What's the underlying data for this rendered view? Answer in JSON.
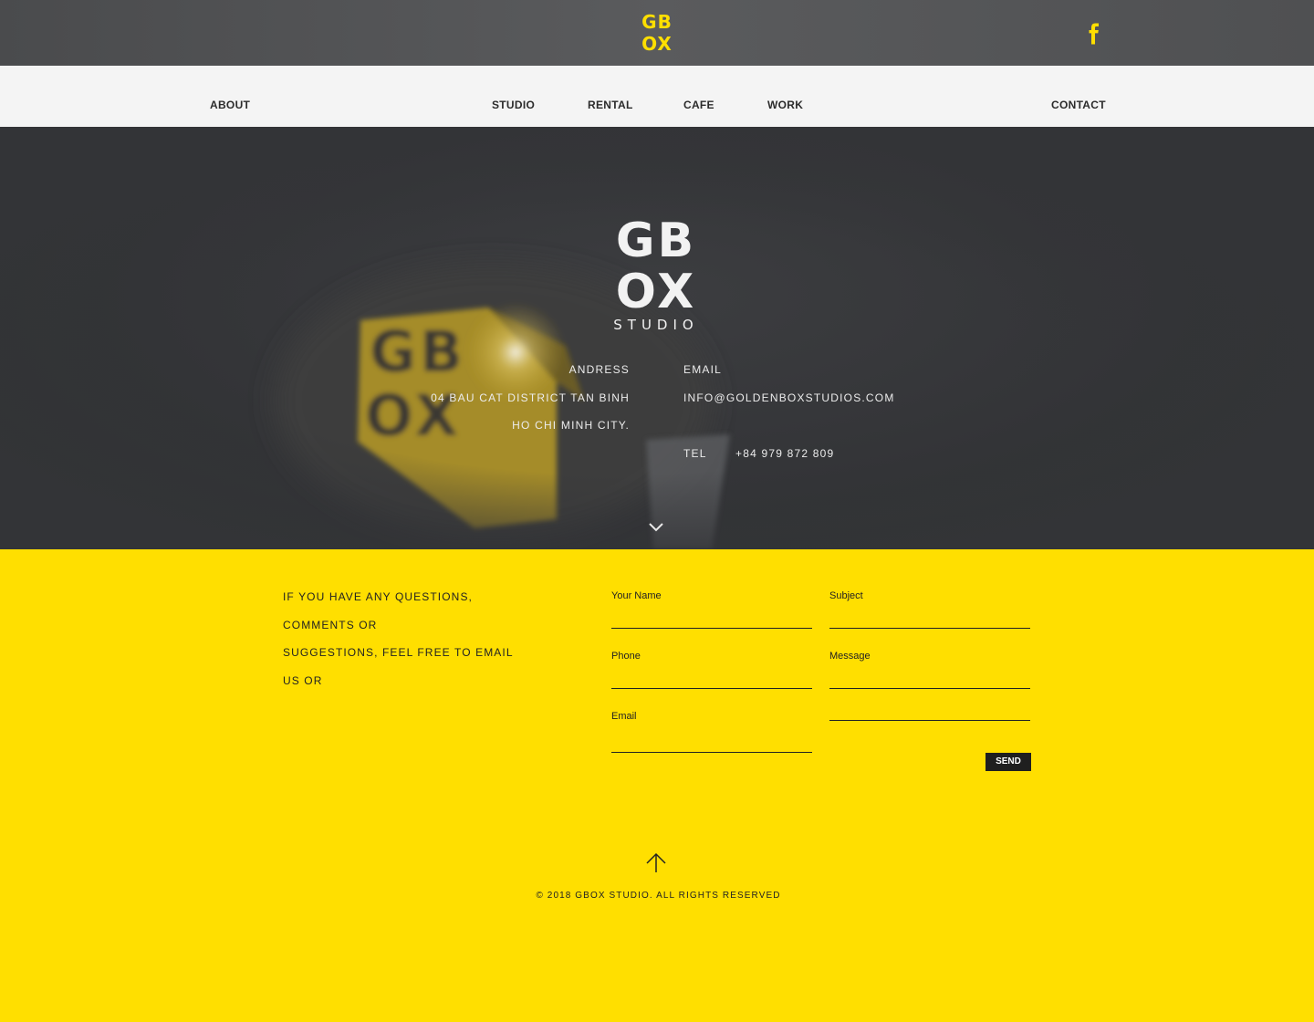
{
  "brand": {
    "logo_top_lines": [
      "GB",
      "OX"
    ],
    "logo_hero_lines": [
      "GB",
      "OX"
    ],
    "logo_hero_sub": "STUDIO",
    "accent": "#ffdf00",
    "dark": "#333437"
  },
  "header": {
    "facebook_icon": "facebook-icon"
  },
  "nav": {
    "about": "ABOUT",
    "studio": "STUDIO",
    "rental": "RENTAL",
    "cafe": "CAFE",
    "work": "WORK",
    "contact": "CONTACT"
  },
  "hero": {
    "address_label": "ANDRESS",
    "address_line1": "04 BAU CAT DISTRICT TAN BINH",
    "address_line2": "HO CHI MINH CITY.",
    "email_label": "EMAIL",
    "email_value": "INFO@GOLDENBOXSTUDIOS.COM",
    "tel_label": "TEL",
    "tel_value": "+84 979 872 809",
    "scroll_icon": "chevron-down-icon"
  },
  "contact": {
    "lead_lines": [
      "IF YOU HAVE ANY QUESTIONS,",
      "COMMENTS OR",
      "SUGGESTIONS, FEEL FREE TO EMAIL",
      "US OR"
    ],
    "fields": {
      "name": "Your Name",
      "subject": "Subject",
      "phone": "Phone",
      "message": "Message",
      "email": "Email"
    },
    "send_label": "SEND"
  },
  "footer": {
    "up_icon": "arrow-up-icon",
    "copyright": "© 2018 GBOX STUDIO. ALL RIGHTS RESERVED"
  }
}
